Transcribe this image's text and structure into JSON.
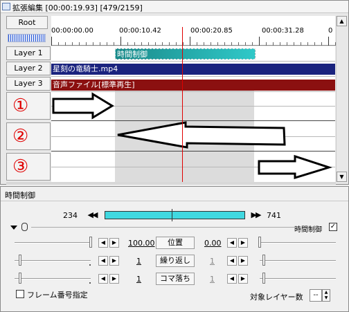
{
  "ext_edit": {
    "title": "拡張編集 [00:00:19.93] [479/2159]",
    "root_label": "Root",
    "ruler_times": [
      "00:00:00.00",
      "00:00:10.42",
      "00:00:20.85",
      "00:00:31.28",
      "0"
    ],
    "layers": [
      "Layer  1",
      "Layer  2",
      "Layer  3"
    ],
    "circled": [
      "①",
      "②",
      "③"
    ],
    "clips": {
      "clip1": "時間制御",
      "clip2": "星刻の竜騎士.mp4",
      "clip3": "音声ファイル[標準再生]"
    },
    "colors": {
      "clip1": "#20a8a8",
      "clip2": "#1a237e",
      "clip3": "#8b1010",
      "cursor": "#e00000"
    }
  },
  "time_control": {
    "title": "時間制御",
    "range_start": "234",
    "range_end": "741",
    "skip_back": "◀◀",
    "skip_fwd": "▶▶",
    "enable_label": "時間制御",
    "enable_checked": "✓",
    "params": [
      {
        "left_value": "100.00",
        "label": "位置",
        "right_value": "0.00"
      },
      {
        "left_value": "1",
        "label": "繰り返し",
        "right_value": "1"
      },
      {
        "left_value": "1",
        "label": "コマ落ち",
        "right_value": "1"
      }
    ],
    "frame_number_label": "フレーム番号指定",
    "target_layers_label": "対象レイヤー数",
    "target_layers_value": "--"
  }
}
